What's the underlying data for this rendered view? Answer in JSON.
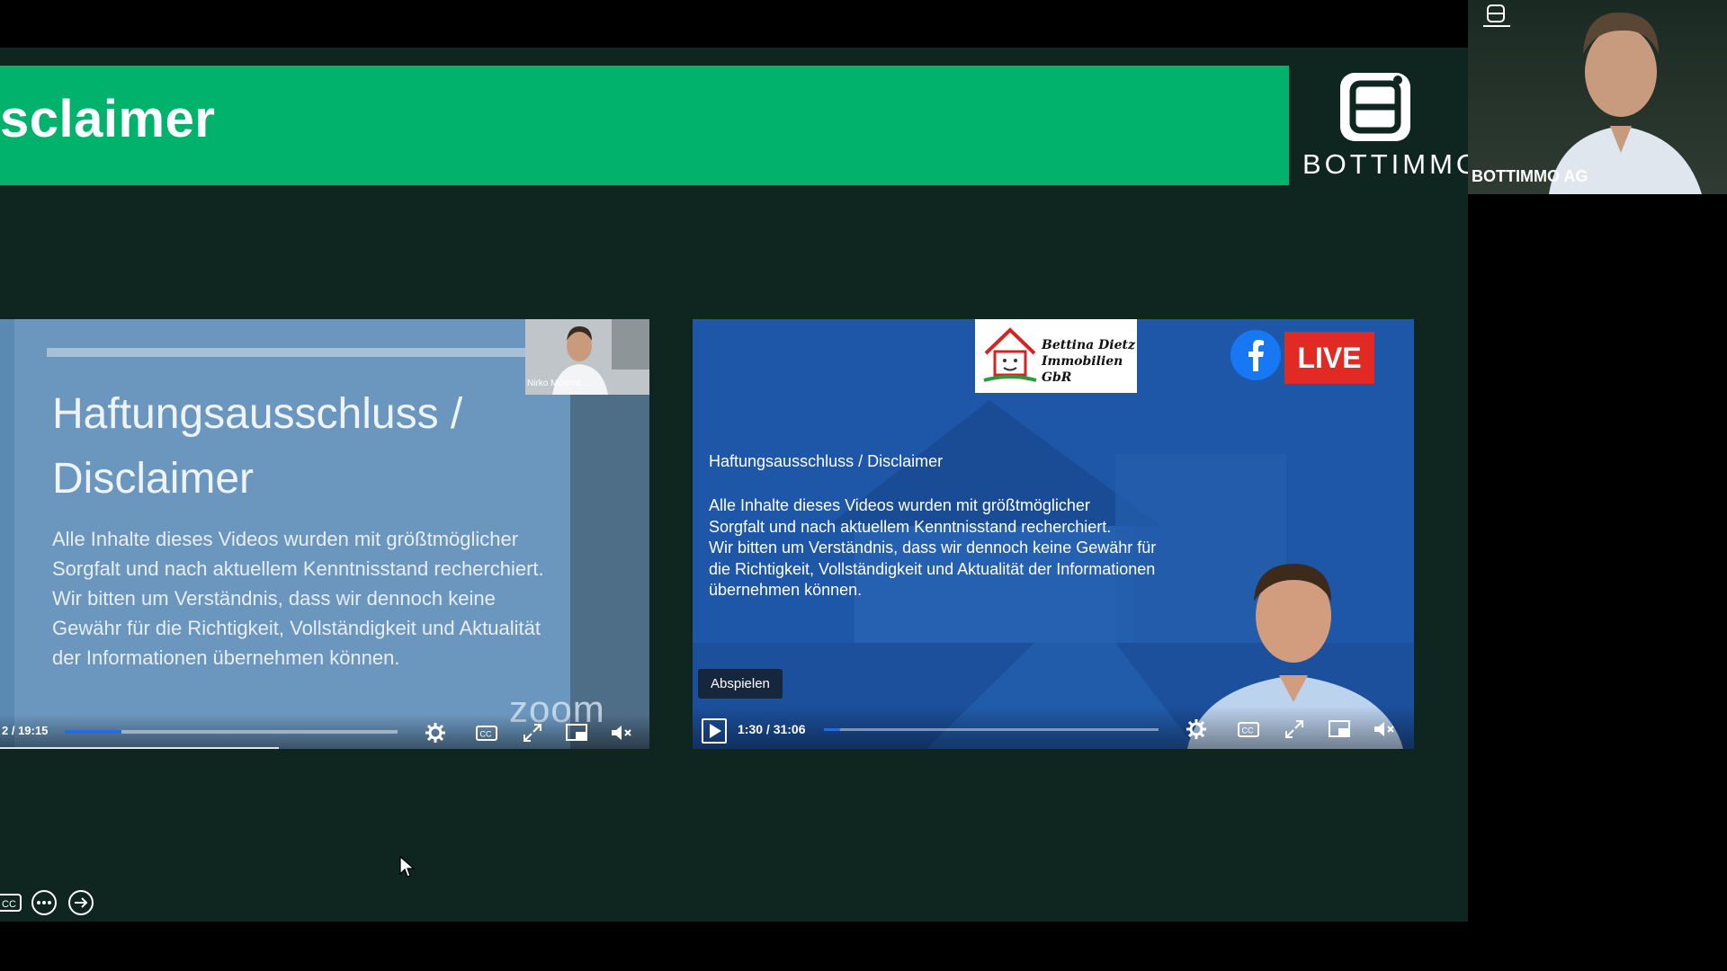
{
  "slide": {
    "title": "sclaimer",
    "brand_name": "BOTTIMMO"
  },
  "presenter_cam": {
    "label": "BOTTIMMO AG"
  },
  "left_video": {
    "title": "Haftungsausschluss / Disclaimer",
    "body": "Alle Inhalte dieses Videos wurden mit größtmöglicher Sorgfalt und nach aktuellem Kenntnisstand recherchiert. Wir bitten um Verständnis, dass wir dennoch keine Gewähr für die Richtigkeit, Vollständigkeit und Aktualität der Informationen übernehmen können.",
    "pip_label": "Nirko Mosent...",
    "watermark": "zoom",
    "time": "2 / 19:15",
    "progress": 0.17
  },
  "right_video": {
    "sign_line1": "Bettina Dietz",
    "sign_line2": "Immobilien GbR",
    "live_badge": "LIVE",
    "title": "Haftungsausschluss / Disclaimer",
    "body_lines": [
      "Alle Inhalte dieses Videos wurden mit größtmöglicher",
      "Sorgfalt und nach aktuellem Kenntnisstand recherchiert.",
      "Wir bitten um Verständnis, dass wir dennoch keine Gewähr für",
      "die Richtigkeit, Vollständigkeit und Aktualität der Informationen",
      "übernehmen können."
    ],
    "tooltip": "Abspielen",
    "time": "1:30 / 31:06",
    "progress": 0.048
  },
  "colors": {
    "brand_green": "#00b26b",
    "slide_bg": "#0e2520",
    "facebook_blue": "#1877f2",
    "live_red": "#e22a25",
    "progress_blue": "#1f6fe0"
  },
  "icons": {
    "player_controls": [
      "settings-icon",
      "captions-icon",
      "fullscreen-icon",
      "pip-icon",
      "mute-icon"
    ],
    "bottom_tools": [
      "captions-icon",
      "more-icon",
      "next-icon"
    ]
  }
}
